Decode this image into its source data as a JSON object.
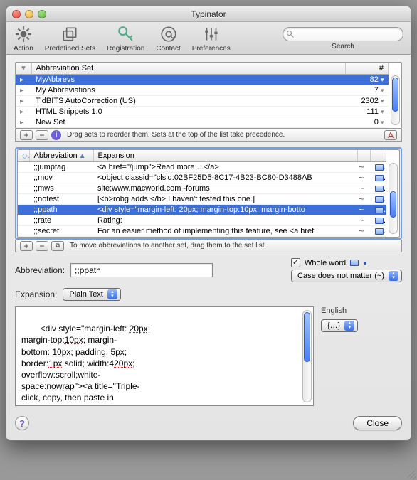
{
  "window": {
    "title": "Typinator"
  },
  "toolbar": {
    "action": "Action",
    "predefined": "Predefined Sets",
    "registration": "Registration",
    "contact": "Contact",
    "preferences": "Preferences",
    "search_label": "Search",
    "search_value": ""
  },
  "sets": {
    "col_set": "Abbreviation Set",
    "col_count": "#",
    "rows": [
      {
        "name": "MyAbbrevs",
        "count": "82"
      },
      {
        "name": "My Abbreviations",
        "count": "7"
      },
      {
        "name": "TidBITS AutoCorrection (US)",
        "count": "2302"
      },
      {
        "name": "HTML Snippets 1.0",
        "count": "111"
      },
      {
        "name": "New Set",
        "count": "0"
      }
    ],
    "hint": "Drag sets to reorder them. Sets at the top of the list take precedence."
  },
  "abbr": {
    "col_abbr": "Abbreviation",
    "col_exp": "Expansion",
    "rows": [
      {
        "a": ";;jumptag",
        "e": "<a href=\"/jump\">Read more ...</a>"
      },
      {
        "a": ";;mov",
        "e": "<object classid=\"clsid:02BF25D5-8C17-4B23-BC80-D3488AB"
      },
      {
        "a": ";;mws",
        "e": "site:www.macworld.com -forums"
      },
      {
        "a": ";;notest",
        "e": "[<b>robg adds:</b> I haven't tested this one.]"
      },
      {
        "a": ";;ppath",
        "e": "<div style=\"margin-left: 20px; margin-top:10px; margin-botto"
      },
      {
        "a": ";;rate",
        "e": "Rating:"
      },
      {
        "a": ";;secret",
        "e": "For an easier method of implementing this feature, see <a href"
      }
    ],
    "hint": "To move abbreviations to another set, drag them to the set list."
  },
  "form": {
    "abbr_label": "Abbreviation:",
    "abbr_value": ";;ppath",
    "whole_word": "Whole word",
    "case_label": "Case does not matter (~)",
    "exp_label": "Expansion:",
    "exp_type": "Plain Text",
    "lang_label": "English",
    "lang_value": "{…}"
  },
  "expansion_text": "<div style=\"margin-left: 20px;\nmargin-top:10px; margin-\nbottom: 10px; padding: 5px;\nborder:1px solid; width:420px;\noverflow:scroll;white-\nspace:nowrap\"><a title=\"Triple-\nclick, copy, then paste in",
  "buttons": {
    "close": "Close"
  }
}
